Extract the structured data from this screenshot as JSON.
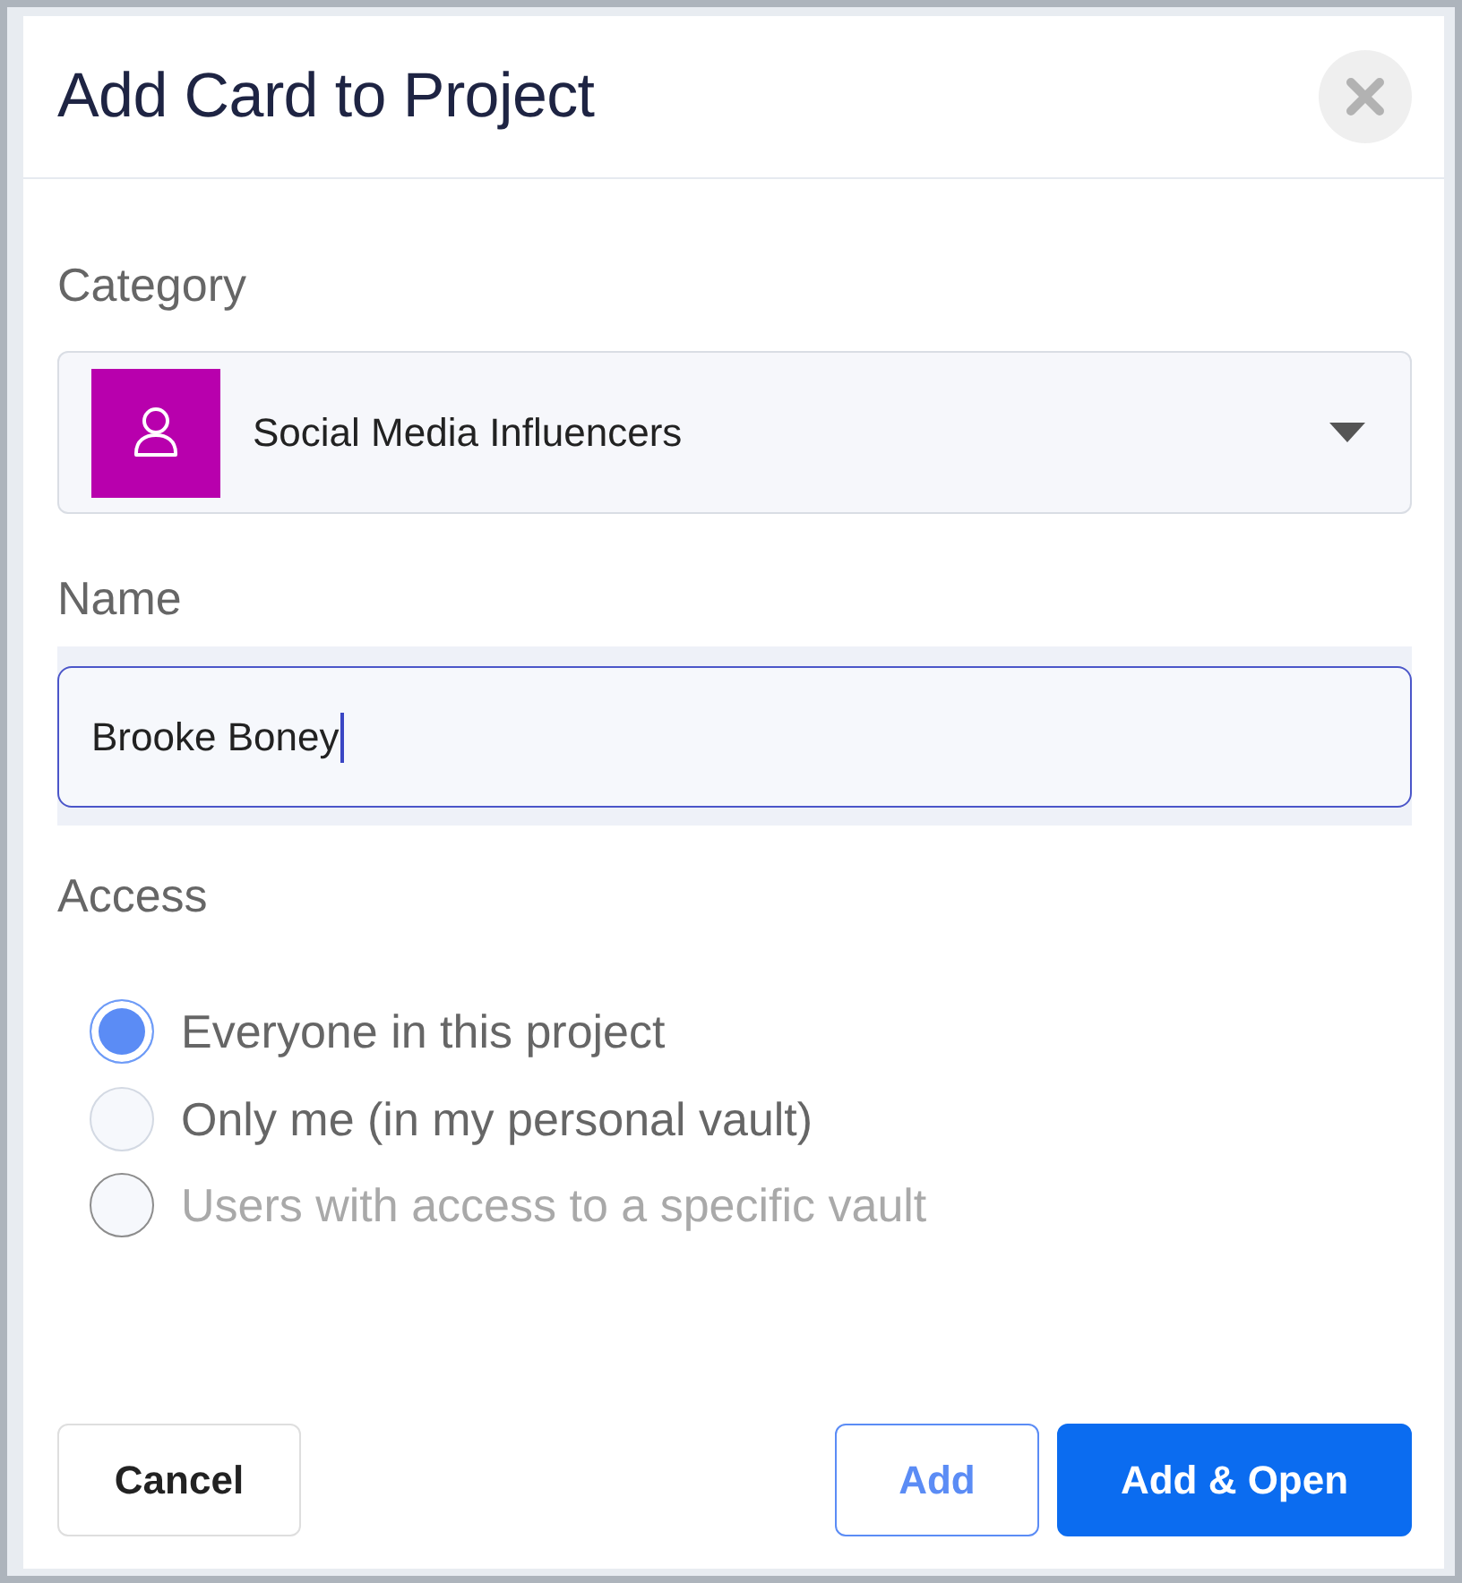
{
  "dialog": {
    "title": "Add Card to Project"
  },
  "category": {
    "label": "Category",
    "value": "Social Media Influencers"
  },
  "name": {
    "label": "Name",
    "value": "Brooke Boney",
    "focused": true
  },
  "access": {
    "label": "Access",
    "options": [
      {
        "label": "Everyone in this project",
        "selected": true,
        "disabled": false
      },
      {
        "label": "Only me (in my personal vault)",
        "selected": false,
        "disabled": false
      },
      {
        "label": "Users with access to a specific vault",
        "selected": false,
        "disabled": true
      }
    ]
  },
  "buttons": [
    {
      "label": "Cancel",
      "kind": "secondary"
    },
    {
      "label": "Add",
      "kind": "outline"
    },
    {
      "label": "Add & Open",
      "kind": "primary"
    }
  ]
}
